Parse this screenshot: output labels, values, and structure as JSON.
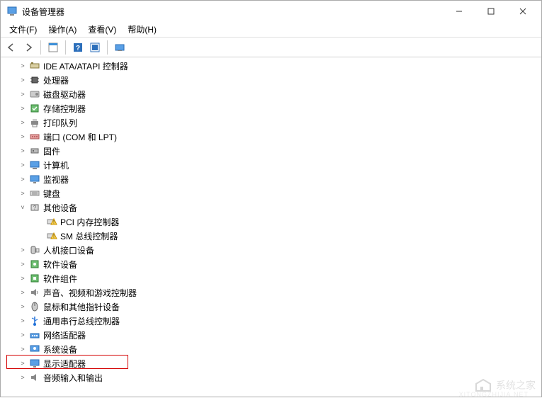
{
  "window": {
    "title": "设备管理器"
  },
  "menu": {
    "file": "文件(F)",
    "action": "操作(A)",
    "view": "查看(V)",
    "help": "帮助(H)"
  },
  "toolbar": {
    "back": "后退",
    "forward": "前进",
    "properties": "属性",
    "help": "帮助",
    "refresh": "刷新",
    "show_hidden": "显示隐藏的设备"
  },
  "tree": [
    {
      "label": "IDE ATA/ATAPI 控制器",
      "icon": "ide",
      "expanded": false
    },
    {
      "label": "处理器",
      "icon": "chip",
      "expanded": false
    },
    {
      "label": "磁盘驱动器",
      "icon": "disk",
      "expanded": false
    },
    {
      "label": "存储控制器",
      "icon": "storage",
      "expanded": false
    },
    {
      "label": "打印队列",
      "icon": "printer",
      "expanded": false
    },
    {
      "label": "端口 (COM 和 LPT)",
      "icon": "port",
      "expanded": false
    },
    {
      "label": "固件",
      "icon": "firmware",
      "expanded": false
    },
    {
      "label": "计算机",
      "icon": "computer",
      "expanded": false
    },
    {
      "label": "监视器",
      "icon": "monitor",
      "expanded": false
    },
    {
      "label": "键盘",
      "icon": "keyboard",
      "expanded": false
    },
    {
      "label": "其他设备",
      "icon": "other",
      "expanded": true,
      "children": [
        {
          "label": "PCI 内存控制器",
          "icon": "warn"
        },
        {
          "label": "SM 总线控制器",
          "icon": "warn"
        }
      ]
    },
    {
      "label": "人机接口设备",
      "icon": "hid",
      "expanded": false
    },
    {
      "label": "软件设备",
      "icon": "soft",
      "expanded": false
    },
    {
      "label": "软件组件",
      "icon": "component",
      "expanded": false
    },
    {
      "label": "声音、视频和游戏控制器",
      "icon": "sound",
      "expanded": false
    },
    {
      "label": "鼠标和其他指针设备",
      "icon": "mouse",
      "expanded": false
    },
    {
      "label": "通用串行总线控制器",
      "icon": "usb",
      "expanded": false
    },
    {
      "label": "网络适配器",
      "icon": "network",
      "expanded": false
    },
    {
      "label": "系统设备",
      "icon": "system",
      "expanded": false
    },
    {
      "label": "显示适配器",
      "icon": "display",
      "expanded": false,
      "highlighted": true
    },
    {
      "label": "音频输入和输出",
      "icon": "audio",
      "expanded": false
    }
  ],
  "watermark": {
    "text": "系统之家",
    "sub": "XITONGZHIJIA.NET"
  }
}
